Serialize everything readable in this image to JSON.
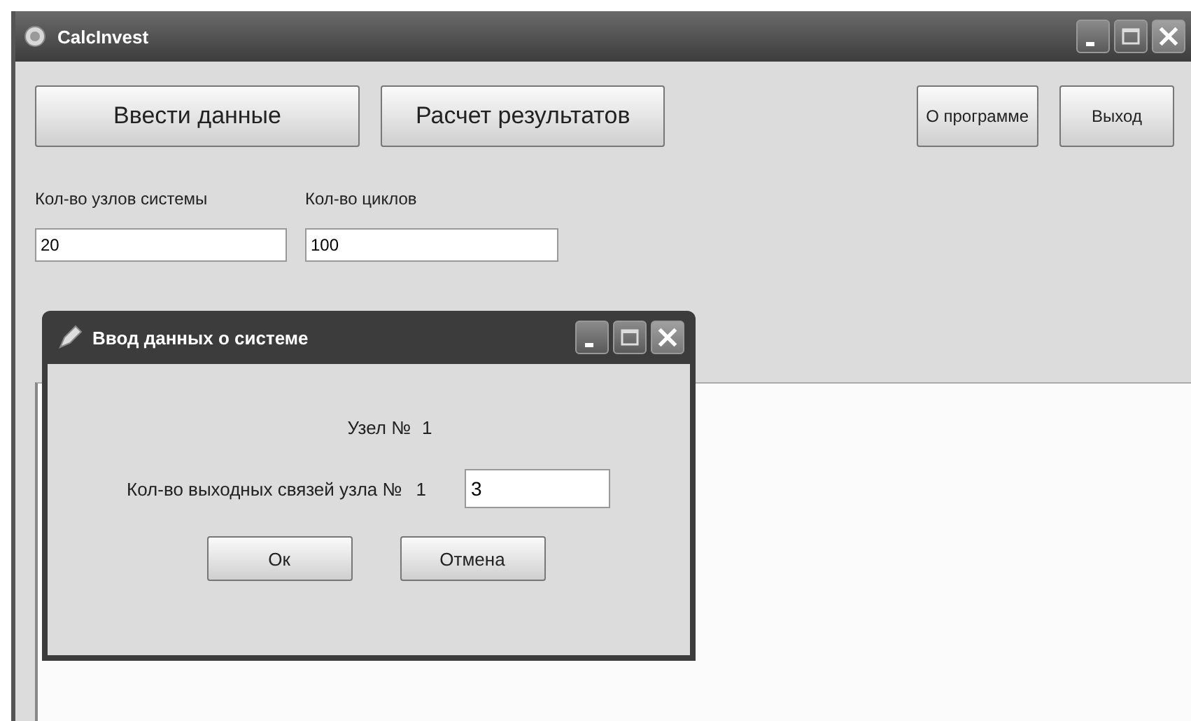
{
  "window": {
    "title": "CalcInvest"
  },
  "toolbar": {
    "left_buttons": [
      "Ввести данные",
      "Расчет результатов"
    ],
    "right_buttons": [
      "О программе",
      "Выход"
    ]
  },
  "fields": [
    {
      "label": "Кол-во узлов системы",
      "value": "20"
    },
    {
      "label": "Кол-во циклов",
      "value": "100"
    }
  ],
  "dialog": {
    "title": "Ввод данных о системе",
    "node_label": "Узел №",
    "node_value": "1",
    "links_label": "Кол-во выходных связей узла №",
    "links_node": "1",
    "links_value": "3",
    "buttons": [
      "Ок",
      "Отмена"
    ]
  }
}
